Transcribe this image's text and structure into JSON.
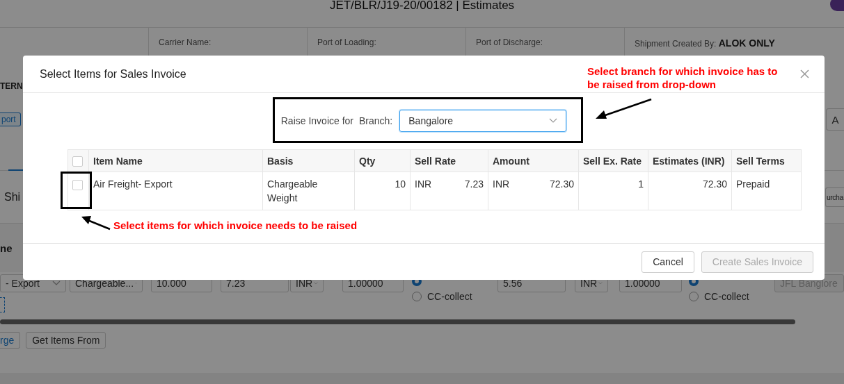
{
  "page": {
    "title": "JET/BLR/J19-20/00182 | Estimates",
    "info": [
      {
        "label": "Carrier Name:"
      },
      {
        "label": "Port of Loading:"
      },
      {
        "label": "Port of Discharge:"
      },
      {
        "label": "Shipment Created By:",
        "value": "ALOK ONLY"
      }
    ],
    "left_fragment": "TERN",
    "tag": "port",
    "action_button": "A",
    "section_title": "Shi",
    "section_button": "urcha",
    "column_header": "ne",
    "row": [
      {
        "kind": "select",
        "value": "- Export"
      },
      {
        "kind": "select",
        "value": "Chargeable..."
      },
      {
        "kind": "input",
        "value": "10.000"
      },
      {
        "kind": "input",
        "value": "7.23"
      },
      {
        "kind": "select",
        "value": "INR"
      },
      {
        "kind": "input",
        "value": "1.00000"
      },
      {
        "kind": "radios",
        "options": [
          {
            "selected": true
          },
          {
            "label": "CC-collect",
            "selected": false
          }
        ]
      },
      {
        "kind": "input",
        "value": "5.56"
      },
      {
        "kind": "select",
        "value": "INR"
      },
      {
        "kind": "input",
        "value": "1.00000"
      },
      {
        "kind": "radios",
        "options": [
          {
            "selected": true
          },
          {
            "label": "CC-collect",
            "selected": false
          }
        ]
      },
      {
        "kind": "disabled",
        "value": "JFL Banglore"
      }
    ],
    "buttons": [
      {
        "kind": "link",
        "label": "rge"
      },
      {
        "kind": "button",
        "label": "Get Items From"
      }
    ]
  },
  "modal": {
    "title": "Select Items for Sales Invoice",
    "raise_label": "Raise Invoice for",
    "branch_label": "Branch:",
    "branch_value": "Bangalore",
    "columns": [
      "Item Name",
      "Basis",
      "Qty",
      "Sell Rate",
      "Amount",
      "Sell Ex. Rate",
      "Estimates (INR)",
      "Sell Terms"
    ],
    "all_checked": false,
    "rows": [
      {
        "checked": false,
        "item": "Air Freight- Export",
        "basis": "Chargeable Weight",
        "qty": "10",
        "sell_currency": "INR",
        "sell_rate": "7.23",
        "amount_currency": "INR",
        "amount": "72.30",
        "ex_rate": "1",
        "estimate": "72.30",
        "terms": "Prepaid"
      }
    ],
    "buttons": [
      {
        "label": "Cancel",
        "disabled": false
      },
      {
        "label": "Create Sales Invoice",
        "disabled": true
      }
    ]
  },
  "annotations": [
    "Select branch for which invoice has to be raised from drop-down",
    "Select items for which invoice needs to be raised"
  ]
}
